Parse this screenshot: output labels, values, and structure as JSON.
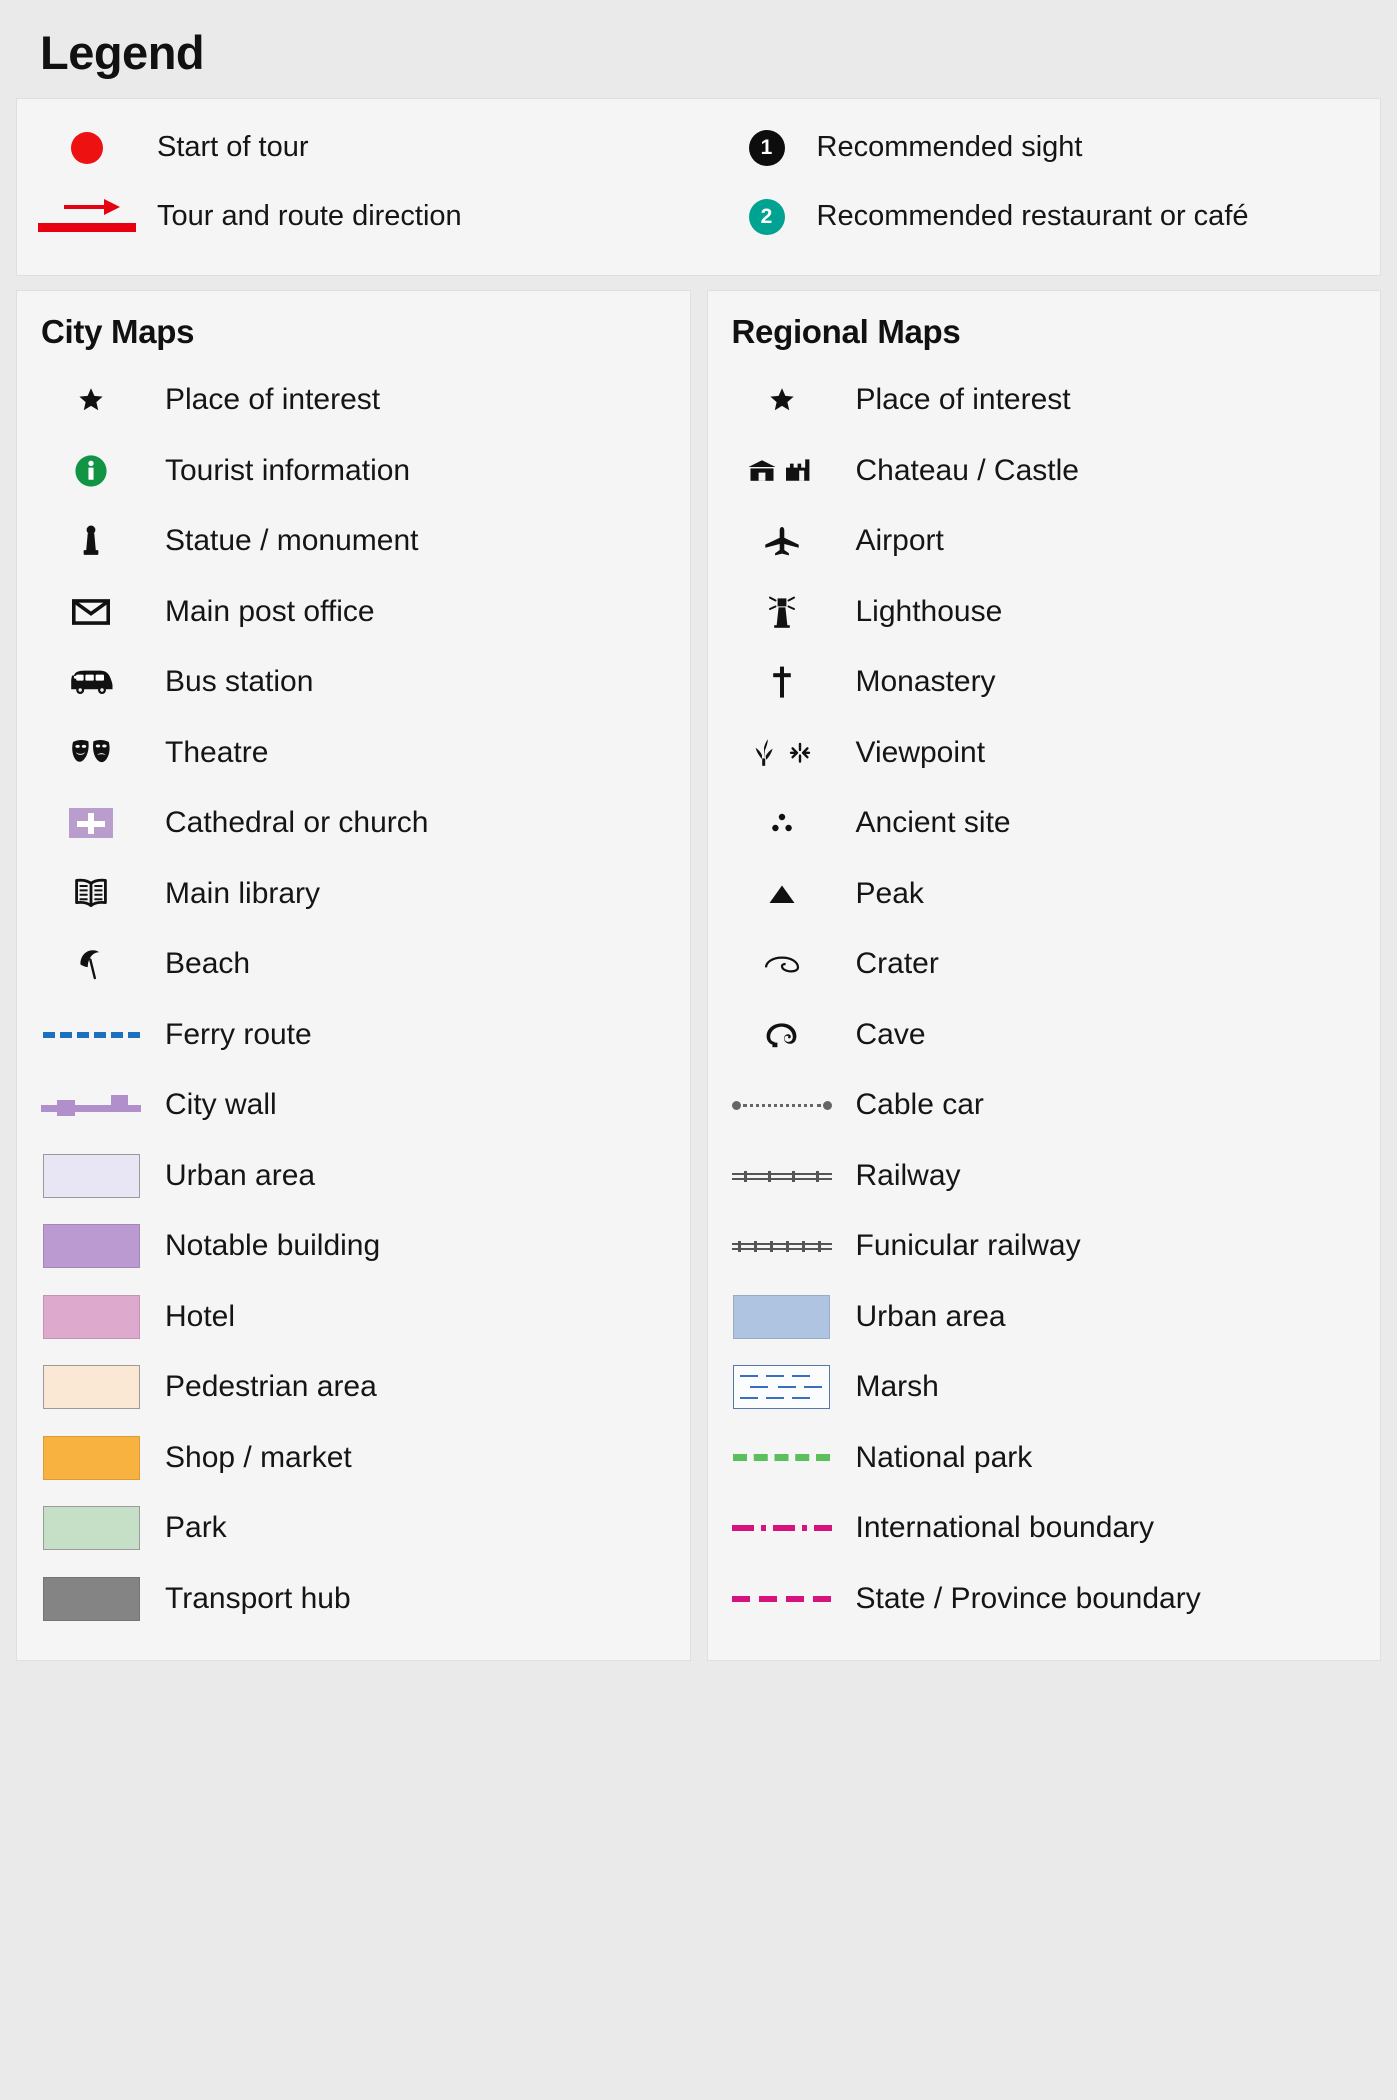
{
  "title": "Legend",
  "top": {
    "left_items": [
      {
        "symbol": "red-dot",
        "label": "Start of tour"
      },
      {
        "symbol": "tour-arrow",
        "label": "Tour and route direction"
      }
    ],
    "right_items": [
      {
        "symbol": "black-numbered-marker",
        "number": "1",
        "label": "Recommended sight"
      },
      {
        "symbol": "teal-numbered-marker",
        "number": "2",
        "label": "Recommended restaurant or café"
      }
    ]
  },
  "city_maps": {
    "title": "City Maps",
    "items": [
      {
        "symbol": "star-icon",
        "label": "Place of interest"
      },
      {
        "symbol": "tourist-information-icon",
        "label": "Tourist information"
      },
      {
        "symbol": "statue-monument-icon",
        "label": "Statue / monument"
      },
      {
        "symbol": "envelope-icon",
        "label": "Main post office"
      },
      {
        "symbol": "bus-icon",
        "label": "Bus station"
      },
      {
        "symbol": "theatre-masks-icon",
        "label": "Theatre"
      },
      {
        "symbol": "cathedral-church-icon",
        "label": "Cathedral or church"
      },
      {
        "symbol": "open-book-icon",
        "label": "Main library"
      },
      {
        "symbol": "beach-parasol-icon",
        "label": "Beach"
      },
      {
        "symbol": "ferry-route-line",
        "label": "Ferry route"
      },
      {
        "symbol": "city-wall-line",
        "label": "City wall"
      },
      {
        "symbol": "urban-area-swatch",
        "label": "Urban area"
      },
      {
        "symbol": "notable-building-swatch",
        "label": "Notable building"
      },
      {
        "symbol": "hotel-swatch",
        "label": "Hotel"
      },
      {
        "symbol": "pedestrian-area-swatch",
        "label": "Pedestrian area"
      },
      {
        "symbol": "shop-market-swatch",
        "label": "Shop / market"
      },
      {
        "symbol": "park-swatch",
        "label": "Park"
      },
      {
        "symbol": "transport-hub-swatch",
        "label": "Transport hub"
      }
    ]
  },
  "regional_maps": {
    "title": "Regional Maps",
    "items": [
      {
        "symbol": "star-icon",
        "label": "Place of interest"
      },
      {
        "symbol": "chateau-castle-icon",
        "label": "Chateau / Castle"
      },
      {
        "symbol": "airplane-icon",
        "label": "Airport"
      },
      {
        "symbol": "lighthouse-icon",
        "label": "Lighthouse"
      },
      {
        "symbol": "monastery-cross-icon",
        "label": "Monastery"
      },
      {
        "symbol": "viewpoint-icon",
        "label": "Viewpoint"
      },
      {
        "symbol": "ancient-site-icon",
        "label": "Ancient site"
      },
      {
        "symbol": "peak-triangle-icon",
        "label": "Peak"
      },
      {
        "symbol": "crater-icon",
        "label": "Crater"
      },
      {
        "symbol": "cave-icon",
        "label": "Cave"
      },
      {
        "symbol": "cable-car-line",
        "label": "Cable car"
      },
      {
        "symbol": "railway-line",
        "label": "Railway"
      },
      {
        "symbol": "funicular-railway-line",
        "label": "Funicular railway"
      },
      {
        "symbol": "urban-area-swatch",
        "label": "Urban area"
      },
      {
        "symbol": "marsh-swatch",
        "label": "Marsh"
      },
      {
        "symbol": "national-park-line",
        "label": "National park"
      },
      {
        "symbol": "international-boundary-line",
        "label": "International boundary"
      },
      {
        "symbol": "state-province-boundary-line",
        "label": "State / Province boundary"
      }
    ]
  },
  "colors": {
    "tour_red": "#e60012",
    "start_dot_red": "#ee1111",
    "recommended_sight_badge": "#0d0d0d",
    "recommended_restaurant_badge": "#00a391",
    "tourist_info_green": "#119444",
    "cathedral_purple": "#b99ecd",
    "ferry_blue": "#1d6fc0",
    "city_wall_purple": "#b18fca",
    "urban_area_city": "#e8e6f5",
    "notable_building": "#bb9ad2",
    "hotel": "#ddaacd",
    "pedestrian_area": "#fae7d4",
    "shop_market": "#f7b23f",
    "park": "#c6e0c8",
    "transport_hub": "#848484",
    "urban_area_regional": "#aec4e0",
    "marsh_blue": "#3a6fbf",
    "national_park_green": "#5bbf5b",
    "boundary_magenta": "#d6127f",
    "railway_grey": "#555555",
    "cable_car_grey": "#666666"
  }
}
